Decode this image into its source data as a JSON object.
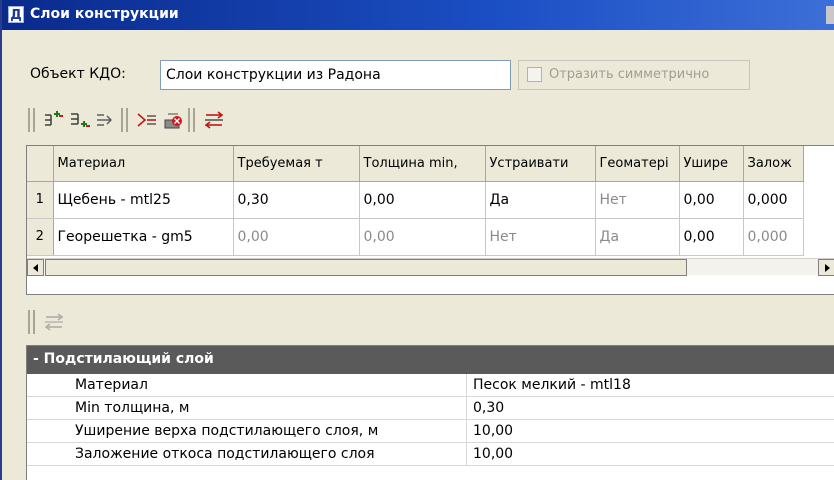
{
  "window": {
    "icon_letter": "Д",
    "title": "Слои конструкции"
  },
  "object": {
    "label": "Объект КДО:",
    "value": "Слои конструкции из Радона"
  },
  "symmetric": {
    "label": "Отразить симметрично",
    "checked": false,
    "enabled": false
  },
  "toolbar": {
    "buttons": [
      {
        "name": "add-layer-above-icon"
      },
      {
        "name": "add-layer-below-icon"
      },
      {
        "name": "move-layer-icon"
      },
      {
        "name": "insert-layer-icon"
      },
      {
        "name": "delete-layer-icon"
      },
      {
        "name": "swap-layers-icon"
      }
    ]
  },
  "grid": {
    "columns": [
      "Материал",
      "Требуемая т",
      "Толщина min,",
      "Устраивати",
      "Геоматері",
      "Ушире",
      "Залож"
    ],
    "rows": [
      {
        "num": "1",
        "cells": [
          "Щебень - mtl25",
          "0,30",
          "0,00",
          "Да",
          "Нет",
          "0,00",
          "0,000"
        ],
        "dim": [
          false,
          false,
          false,
          false,
          true,
          false,
          false
        ]
      },
      {
        "num": "2",
        "cells": [
          "Георешетка - gm5",
          "0,00",
          "0,00",
          "Нет",
          "Да",
          "0,00",
          "0,000"
        ],
        "dim": [
          false,
          true,
          true,
          true,
          true,
          false,
          true
        ]
      }
    ]
  },
  "properties": {
    "group_title": "- Подстилающий слой",
    "rows": [
      {
        "name": "Материал",
        "value": "Песок мелкий - mtl18"
      },
      {
        "name": "Min толщина, м",
        "value": "0,30"
      },
      {
        "name": "Уширение верха подстилающего слоя, м",
        "value": "10,00"
      },
      {
        "name": "Заложение откоса подстилающего слоя",
        "value": "10,00"
      }
    ]
  },
  "colors": {
    "titlebar": "#1b4fc4",
    "group_header": "#5a5a5a",
    "disabled_text": "#8a8a8a"
  }
}
